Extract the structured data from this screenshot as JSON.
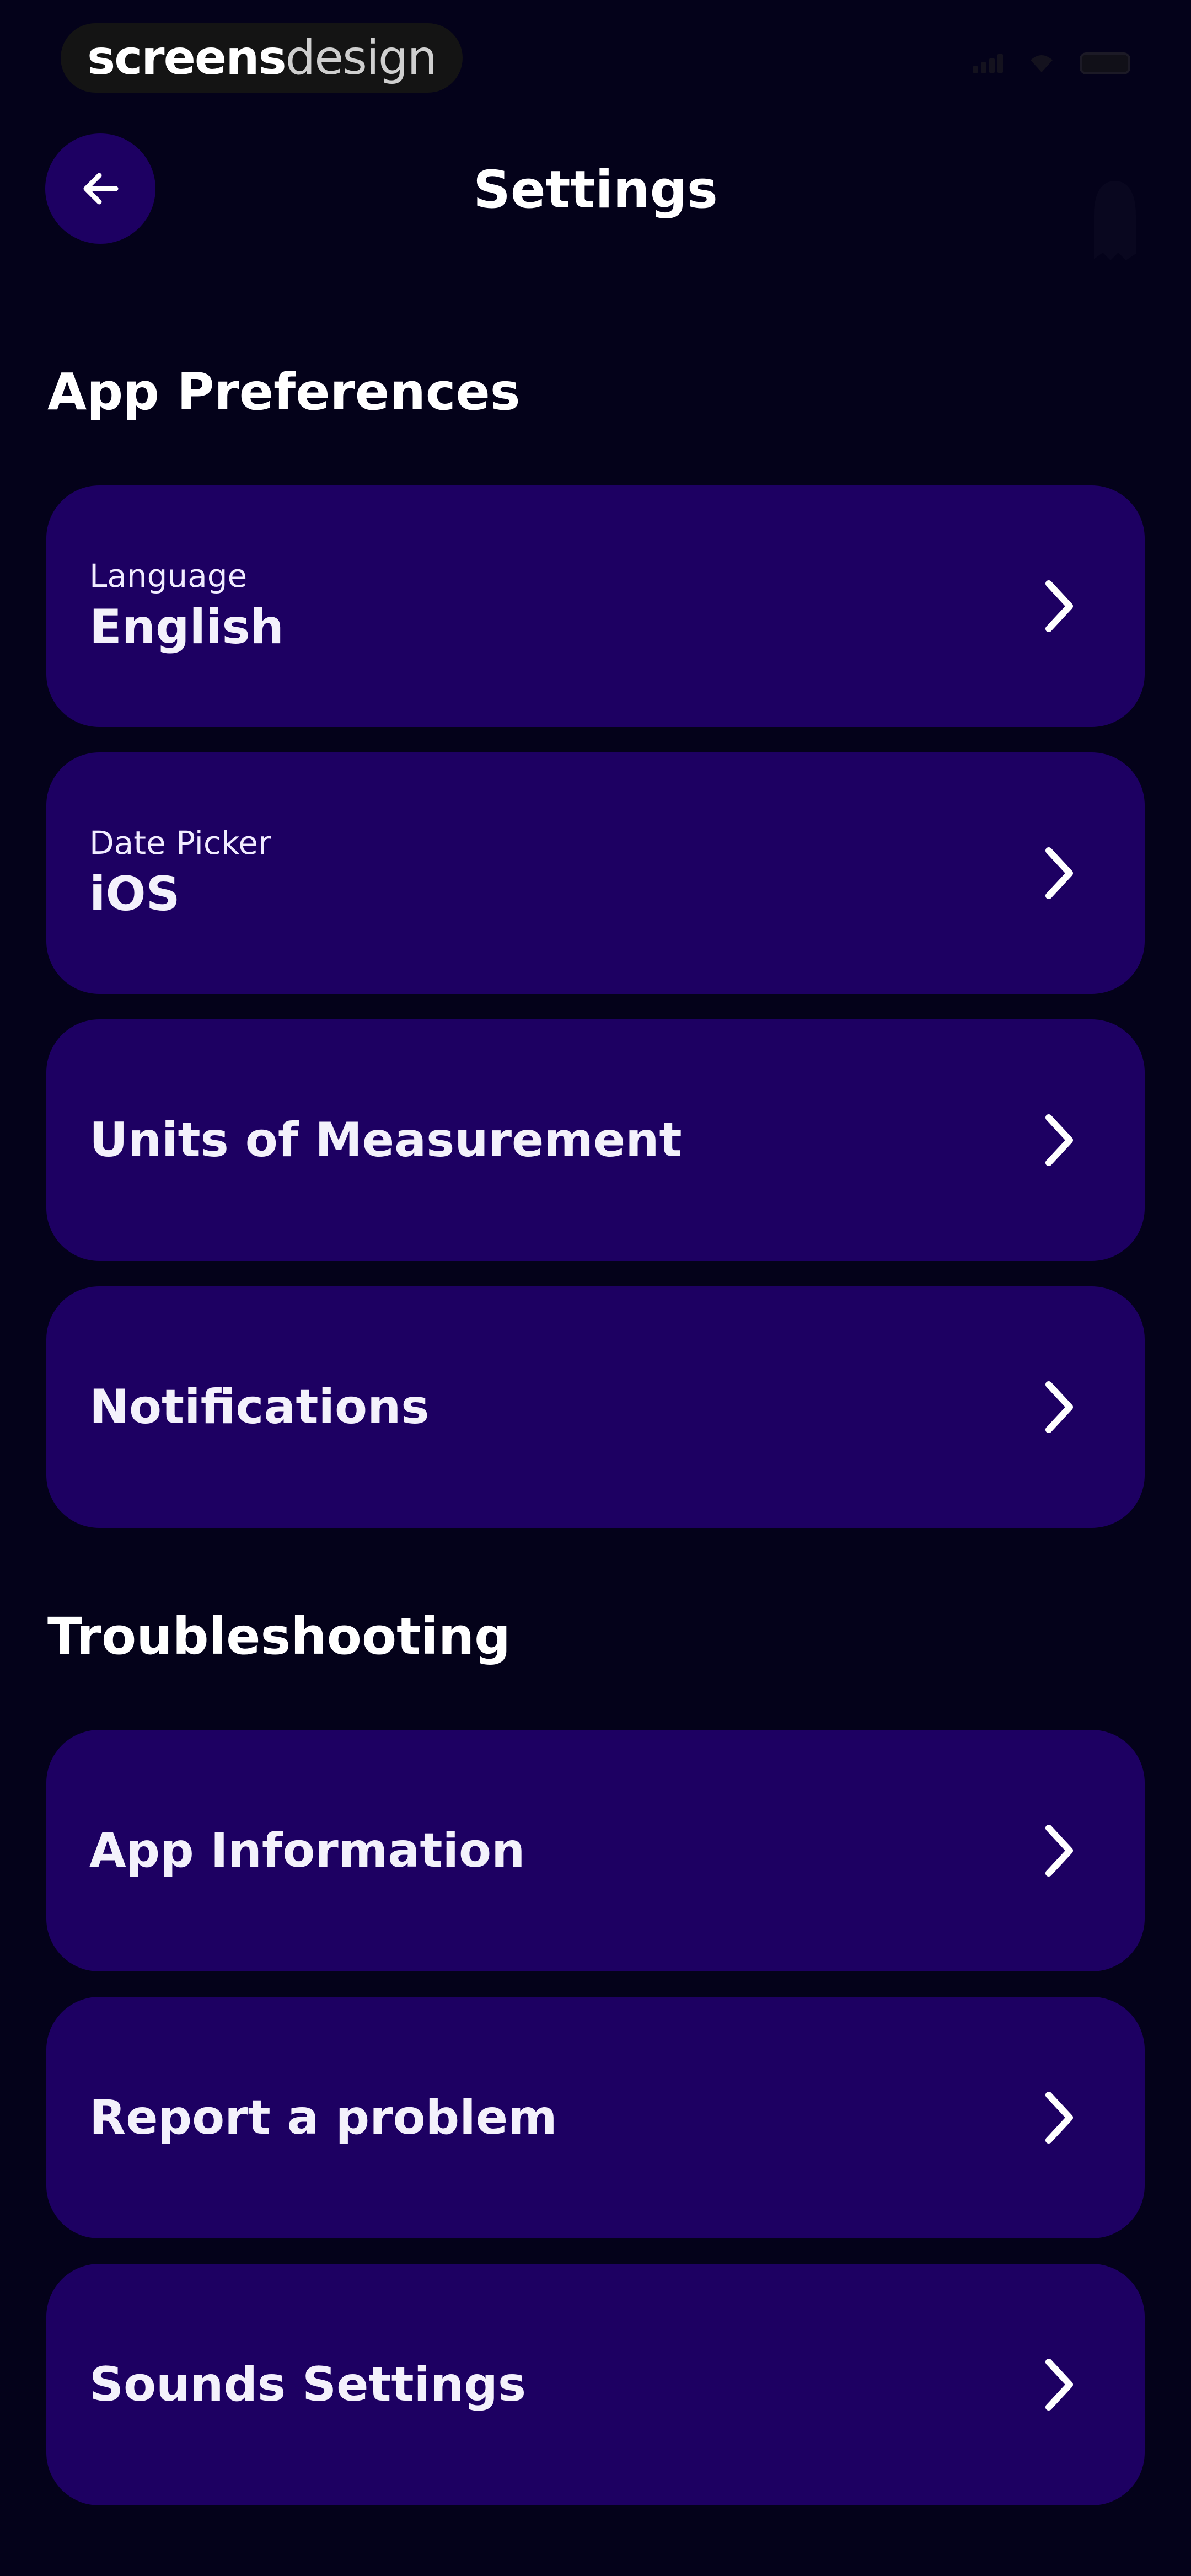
{
  "status_bar": {
    "brand_part1": "screens",
    "brand_part2": "design",
    "icons": [
      "signal-icon",
      "wifi-icon",
      "battery-icon"
    ]
  },
  "header": {
    "title": "Settings",
    "back_icon": "arrow-left-icon",
    "right_icon": "ghost-icon"
  },
  "sections": [
    {
      "title": "App Preferences",
      "items": [
        {
          "caption": "Language",
          "value": "English"
        },
        {
          "caption": "Date Picker",
          "value": "iOS"
        },
        {
          "label": "Units of Measurement"
        },
        {
          "label": "Notifications"
        }
      ]
    },
    {
      "title": "Troubleshooting",
      "items": [
        {
          "label": "App Information"
        },
        {
          "label": "Report a problem"
        },
        {
          "label": "Sounds Settings"
        }
      ]
    }
  ],
  "colors": {
    "background": "#04021a",
    "card": "#1d0062",
    "text": "#ffffff"
  }
}
